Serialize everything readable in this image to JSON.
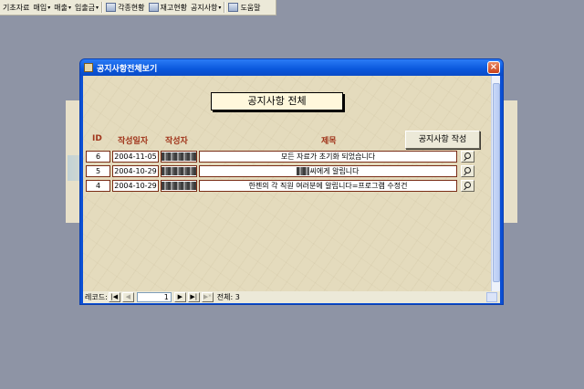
{
  "menubar": {
    "items": [
      {
        "label": "기초자료",
        "has_arrow": false
      },
      {
        "label": "매입",
        "has_arrow": true
      },
      {
        "label": "매출",
        "has_arrow": true
      },
      {
        "label": "입출금",
        "has_arrow": true
      },
      {
        "label": "각종현황",
        "has_arrow": false,
        "icon": "report-icon"
      },
      {
        "label": "재고현황",
        "has_arrow": false,
        "icon": "inventory-icon"
      },
      {
        "label": "공지사항",
        "has_arrow": true
      },
      {
        "label": "도움말",
        "has_arrow": false,
        "icon": "help-icon"
      }
    ]
  },
  "window": {
    "title": "공지사항전체보기",
    "close_label": "×"
  },
  "form": {
    "heading": "공지사항 전체",
    "new_button": "공지사항 작성",
    "columns": {
      "id": "ID",
      "date": "작성일자",
      "author": "작성자",
      "subject": "제목"
    },
    "rows": [
      {
        "id": "6",
        "date": "2004-11-05",
        "subject_prefix": "",
        "subject": "모든 자료가 초기화 되었습니다"
      },
      {
        "id": "5",
        "date": "2004-10-29",
        "subject_prefix": "redacted",
        "subject": "씨에게 알립니다"
      },
      {
        "id": "4",
        "date": "2004-10-29",
        "subject_prefix": "",
        "subject": "한젠의 각 직원 여러분에 알립니다=프로그램 수정건"
      }
    ]
  },
  "navigation": {
    "record_label": "레코드:",
    "first": "|◀",
    "prev": "◀",
    "current": "1",
    "next": "▶",
    "last": "▶|",
    "new": "▶*",
    "total_label": "전체: 3"
  },
  "colors": {
    "desktop": "#8e94a5",
    "titlebar": "#0a57dc",
    "header_text": "#a0341a",
    "cell_border": "#7a2d16"
  }
}
